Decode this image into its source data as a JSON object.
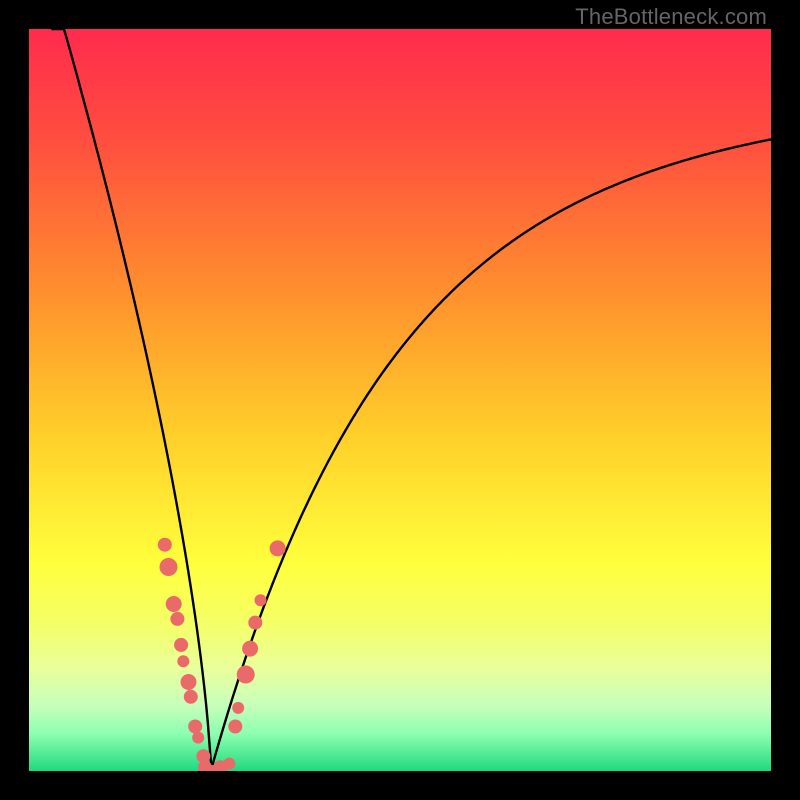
{
  "watermark": "TheBottleneck.com",
  "colors": {
    "gradient_stops": [
      {
        "offset": 0.0,
        "color": "#ff2b4d"
      },
      {
        "offset": 0.15,
        "color": "#ff4e3f"
      },
      {
        "offset": 0.35,
        "color": "#ff8e2e"
      },
      {
        "offset": 0.55,
        "color": "#ffd02a"
      },
      {
        "offset": 0.72,
        "color": "#ffff3c"
      },
      {
        "offset": 0.8,
        "color": "#f5ff66"
      },
      {
        "offset": 0.86,
        "color": "#eaff9a"
      },
      {
        "offset": 0.91,
        "color": "#c8ffba"
      },
      {
        "offset": 0.95,
        "color": "#8cffb0"
      },
      {
        "offset": 1.0,
        "color": "#1fd97f"
      }
    ],
    "marker_fill": "#ea6a6a",
    "marker_stroke": "#c94f4f",
    "curve": "#000000"
  },
  "chart_data": {
    "type": "line",
    "title": "",
    "xlabel": "",
    "ylabel": "",
    "xlim": [
      0,
      1
    ],
    "ylim": [
      0,
      1
    ],
    "notch_x": 0.245,
    "series": [
      {
        "name": "bottleneck-curve",
        "x_range": [
          0.03,
          1.0
        ]
      }
    ],
    "markers_left": [
      {
        "x": 0.183,
        "y": 0.305,
        "r": 7
      },
      {
        "x": 0.188,
        "y": 0.275,
        "r": 9
      },
      {
        "x": 0.195,
        "y": 0.225,
        "r": 8
      },
      {
        "x": 0.2,
        "y": 0.205,
        "r": 7
      },
      {
        "x": 0.205,
        "y": 0.17,
        "r": 7
      },
      {
        "x": 0.208,
        "y": 0.148,
        "r": 6
      },
      {
        "x": 0.215,
        "y": 0.12,
        "r": 8
      },
      {
        "x": 0.218,
        "y": 0.1,
        "r": 7
      },
      {
        "x": 0.224,
        "y": 0.06,
        "r": 7
      },
      {
        "x": 0.228,
        "y": 0.045,
        "r": 6
      },
      {
        "x": 0.235,
        "y": 0.02,
        "r": 7
      }
    ],
    "markers_bottom": [
      {
        "x": 0.237,
        "y": 0.005,
        "r": 7
      },
      {
        "x": 0.248,
        "y": 0.0,
        "r": 6
      },
      {
        "x": 0.258,
        "y": 0.005,
        "r": 7
      },
      {
        "x": 0.27,
        "y": 0.01,
        "r": 6
      }
    ],
    "markers_right": [
      {
        "x": 0.278,
        "y": 0.06,
        "r": 7
      },
      {
        "x": 0.282,
        "y": 0.085,
        "r": 6
      },
      {
        "x": 0.292,
        "y": 0.13,
        "r": 9
      },
      {
        "x": 0.298,
        "y": 0.165,
        "r": 8
      },
      {
        "x": 0.305,
        "y": 0.2,
        "r": 7
      },
      {
        "x": 0.312,
        "y": 0.23,
        "r": 6
      },
      {
        "x": 0.335,
        "y": 0.3,
        "r": 8
      }
    ]
  }
}
